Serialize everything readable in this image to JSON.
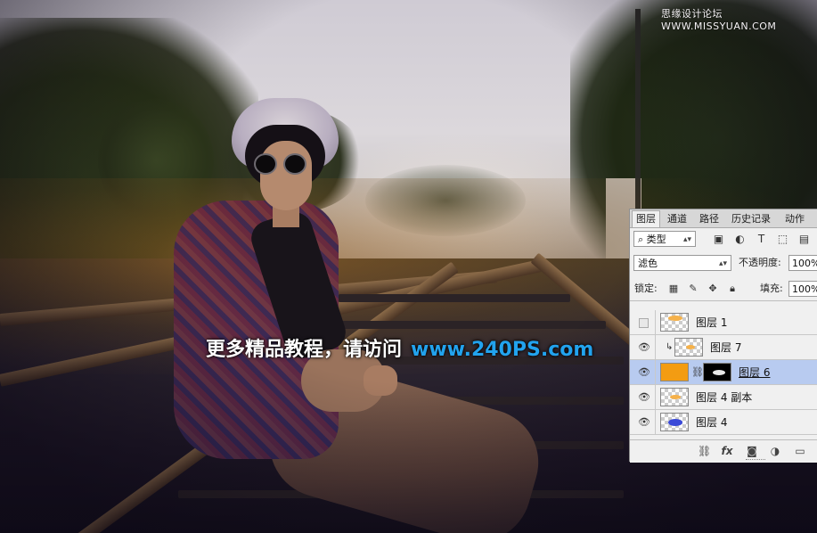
{
  "watermark": "思缘设计论坛  WWW.MISSYUAN.COM",
  "caption": {
    "text": "更多精品教程，请访问",
    "url": "www.240PS.com"
  },
  "panel": {
    "tabs": [
      "图层",
      "通道",
      "路径",
      "历史记录",
      "动作"
    ],
    "active_tab": "图层",
    "filter_kind": "类型",
    "filter_icons": [
      "image-icon",
      "adjustment-icon",
      "type-icon",
      "shape-icon",
      "smart-object-icon"
    ],
    "blend_mode": "滤色",
    "opacity_label": "不透明度:",
    "opacity_value": "100%",
    "lock_label": "锁定:",
    "lock_icons": [
      "lock-transparent-icon",
      "lock-pixels-icon",
      "lock-position-icon",
      "lock-all-icon"
    ],
    "fill_label": "填充:",
    "fill_value": "100%",
    "layers": [
      {
        "name": "图层 1",
        "visible": false,
        "clipped": false,
        "selected": false,
        "thumb": "orange-blob"
      },
      {
        "name": "图层 7",
        "visible": true,
        "clipped": true,
        "selected": false,
        "thumb": "orange-dots"
      },
      {
        "name": "图层 6",
        "visible": true,
        "clipped": false,
        "selected": true,
        "thumb": "fill-orange",
        "has_mask": true
      },
      {
        "name": "图层 4 副本",
        "visible": true,
        "clipped": false,
        "selected": false,
        "thumb": "orange-small"
      },
      {
        "name": "图层 4",
        "visible": true,
        "clipped": false,
        "selected": false,
        "thumb": "blue-blob"
      }
    ],
    "footer_icons": [
      "link-layers-icon",
      "fx-icon",
      "add-mask-icon",
      "adjustment-layer-icon",
      "new-group-icon"
    ]
  },
  "colors": {
    "panel_bg": "#f0f0f0",
    "selected_row": "#b8cbf0",
    "fill_layer": "#f39c12",
    "caption_url": "#22a3ee"
  }
}
